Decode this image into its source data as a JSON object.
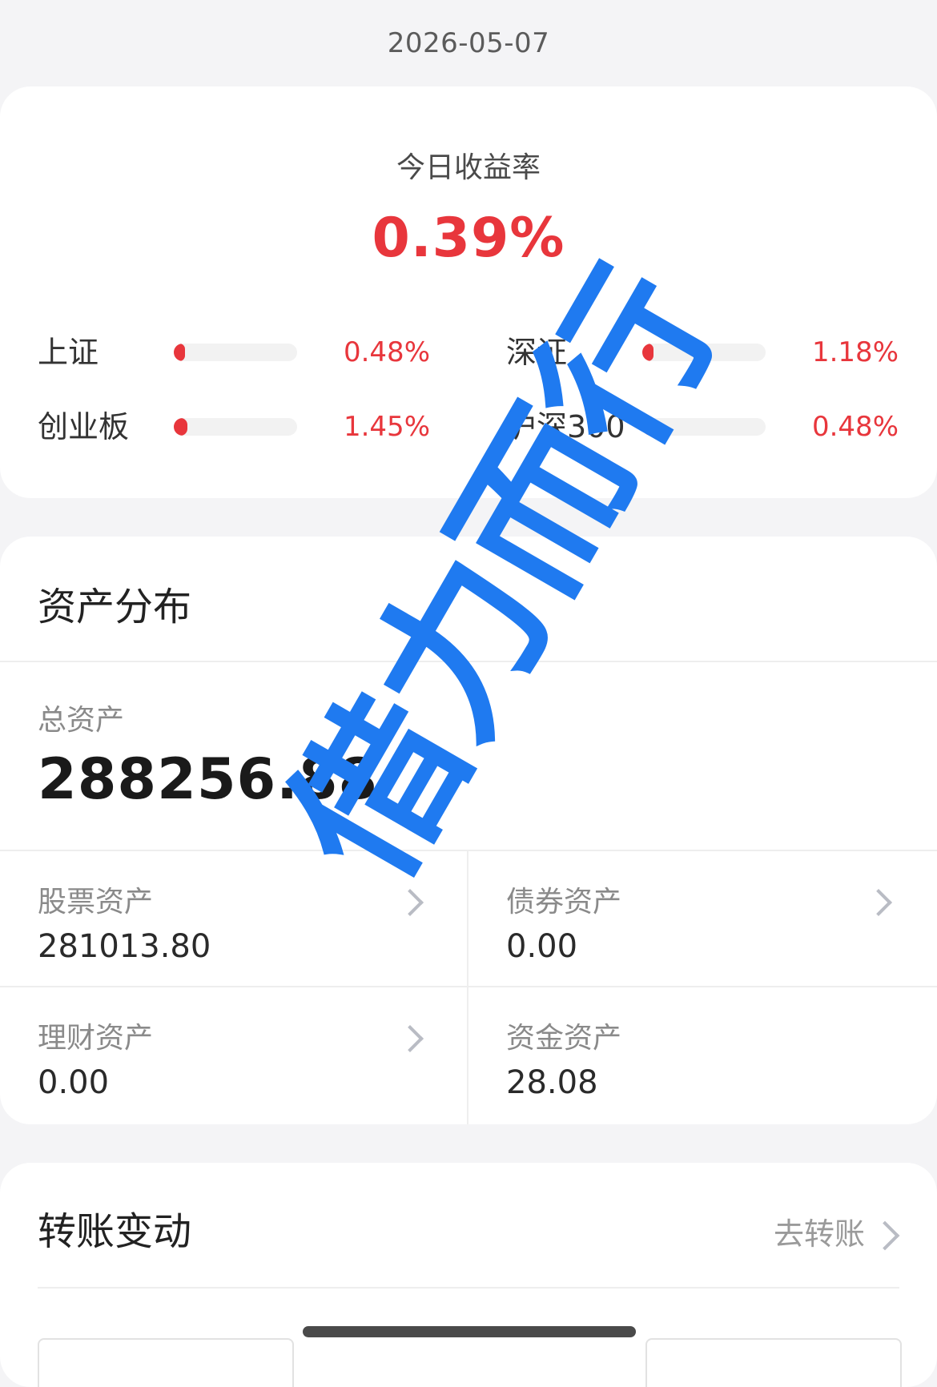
{
  "header": {
    "date": "2026-05-07"
  },
  "today": {
    "label": "今日收益率",
    "value": "0.39%",
    "accent_color": "#e8363c"
  },
  "indices": [
    {
      "name": "上证",
      "percent": "0.48%",
      "fill_fraction": 0.03
    },
    {
      "name": "深证",
      "percent": "1.18%",
      "fill_fraction": 0.09
    },
    {
      "name": "创业板",
      "percent": "1.45%",
      "fill_fraction": 0.11
    },
    {
      "name": "沪深300",
      "percent": "0.48%",
      "fill_fraction": 0.03
    }
  ],
  "assets": {
    "title": "资产分布",
    "total_label": "总资产",
    "total_value": "288256.88",
    "cells": [
      {
        "label": "股票资产",
        "value": "281013.80",
        "has_chevron": true,
        "icon": "chevron-right-icon"
      },
      {
        "label": "债券资产",
        "value": "0.00",
        "has_chevron": true,
        "icon": "chevron-right-icon"
      },
      {
        "label": "理财资产",
        "value": "0.00",
        "has_chevron": true,
        "icon": "chevron-right-icon"
      },
      {
        "label": "资金资产",
        "value": "28.08",
        "has_chevron": false
      }
    ]
  },
  "transfer": {
    "title": "转账变动",
    "link_label": "去转账",
    "link_icon": "chevron-right-icon"
  },
  "watermark": {
    "text": "借力而行",
    "color": "#1f7af0"
  }
}
